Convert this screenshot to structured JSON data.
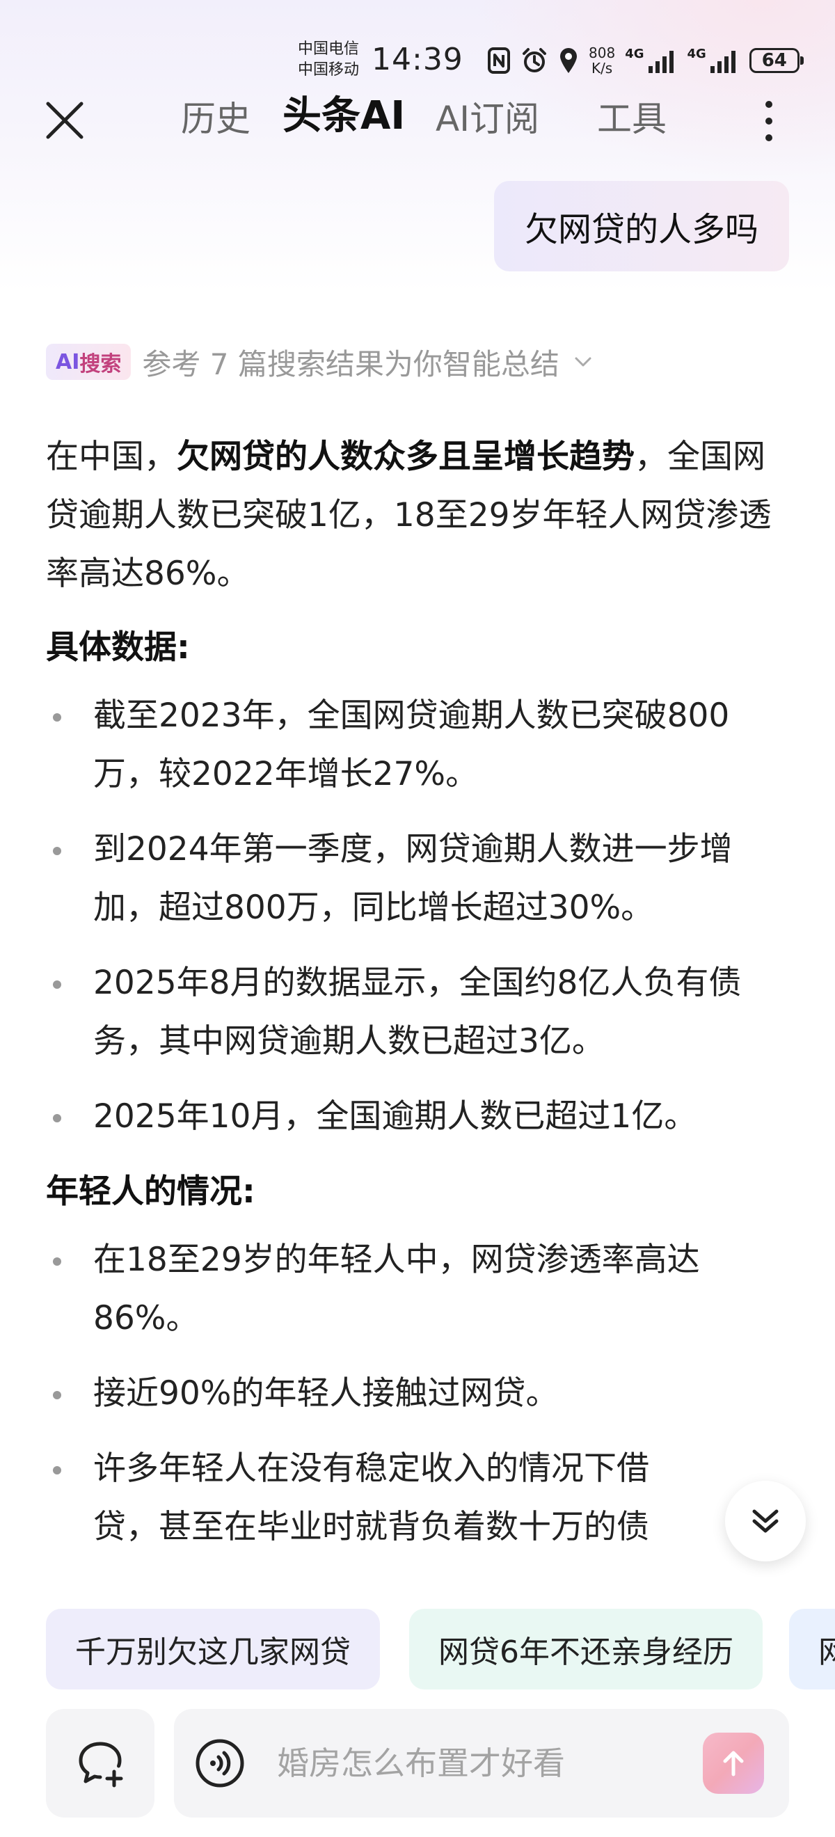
{
  "status_bar": {
    "carrier_1": "中国电信",
    "carrier_2": "中国移动",
    "time": "14:39",
    "net_speed_value": "808",
    "net_speed_unit": "K/s",
    "network_1": "4G",
    "network_2": "4G",
    "battery": "64"
  },
  "nav": {
    "tabs": [
      {
        "label": "历史",
        "active": false
      },
      {
        "label": "头条AI",
        "active": true
      },
      {
        "label": "AI订阅",
        "active": false
      },
      {
        "label": "工具",
        "active": false
      }
    ]
  },
  "user_message": "欠网贷的人多吗",
  "ai_search": {
    "badge_ai": "AI",
    "badge_text": "搜索",
    "summary": "参考 7 篇搜索结果为你智能总结"
  },
  "answer": {
    "intro_prefix": "在中国，",
    "intro_bold": "欠网贷的人数众多且呈增长趋势",
    "intro_rest": "，全国网贷逾期人数已突破1亿，18至29岁年轻人网贷渗透率高达86%。",
    "section_1_title": "具体数据:",
    "section_1_items": [
      "截至2023年，全国网贷逾期人数已突破800万，较2022年增长27%。",
      "到2024年第一季度，网贷逾期人数进一步增加，超过800万，同比增长超过30%。",
      "2025年8月的数据显示，全国约8亿人负有债务，其中网贷逾期人数已超过3亿。",
      "2025年10月，全国逾期人数已超过1亿。"
    ],
    "section_2_title": "年轻人的情况:",
    "section_2_items": [
      "在18至29岁的年轻人中，网贷渗透率高达86%。",
      "接近90%的年轻人接触过网贷。",
      "许多年轻人在没有稳定收入的情况下借贷，甚至在毕业时就背负着数十万的债"
    ]
  },
  "suggestions": [
    "千万别欠这几家网贷",
    "网贷6年不还亲身经历",
    "网"
  ],
  "input": {
    "placeholder": "婚房怎么布置才好看"
  },
  "colors": {
    "ai_badge_purple": "#7b55e0",
    "ai_badge_pink": "#c2417d",
    "chip_purple_bg": "#eeedfb",
    "chip_green_bg": "#e9f8f3",
    "chip_blue_bg": "#e9f1fe",
    "send_button": "#f3a9b8"
  }
}
